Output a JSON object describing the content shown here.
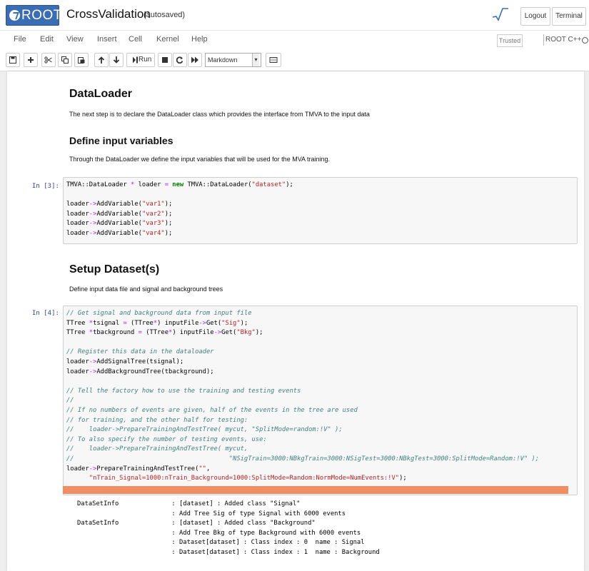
{
  "header": {
    "logo_text": "ROOT",
    "notebook_name": "CrossValidation",
    "autosave_status": "(autosaved)",
    "logout_label": "Logout",
    "terminal_label": "Terminal"
  },
  "menubar": {
    "items": [
      "File",
      "Edit",
      "View",
      "Insert",
      "Cell",
      "Kernel",
      "Help"
    ],
    "trusted_label": "Trusted",
    "kernel_name": "ROOT C++"
  },
  "toolbar": {
    "run_label": "Run",
    "cell_type": "Markdown",
    "icons": [
      "save-icon",
      "insert-cell-icon",
      "cut-icon",
      "copy-icon",
      "paste-icon",
      "move-up-icon",
      "move-down-icon",
      "run-icon",
      "interrupt-icon",
      "restart-icon",
      "restart-run-all-icon",
      "command-palette-icon"
    ]
  },
  "cells": {
    "md1": {
      "h2": "DataLoader",
      "para": "The next step is to declare the DataLoader class which provides the interface from TMVA to the input data",
      "h3": "Define input variables",
      "para2": "Through the DataLoader we define the input variables that will be used for the MVA training."
    },
    "code1": {
      "prompt": "In [3]:",
      "line1": {
        "a": "TMVA::DataLoader ",
        "op": "*",
        "b": " loader ",
        "eq": "=",
        "kw": " new",
        "c": " TMVA::DataLoader(",
        "s": "\"dataset\"",
        "d": ");"
      },
      "vars": [
        "\"var1\"",
        "\"var2\"",
        "\"var3\"",
        "\"var4\""
      ],
      "call_prefix": "loader",
      "arrow": "->",
      "call_name": "AddVariable(",
      "call_end": ");"
    },
    "md2": {
      "h2": "Setup Dataset(s)",
      "para": "Define input data file and signal and background trees"
    },
    "code2": {
      "prompt": "In [4]:",
      "c1": "// Get signal and background data from input file",
      "l2a": "TTree ",
      "l2op": "*",
      "l2b": "tsignal ",
      "l2eq": "=",
      "l2c": " (TTree",
      "l2op2": "*",
      "l2d": ") inputFile",
      "l2arrow": "->",
      "l2e": "Get(",
      "l2s": "\"Sig\"",
      "l2f": ");",
      "l3a": "TTree ",
      "l3op": "*",
      "l3b": "tbackground ",
      "l3eq": "=",
      "l3c": " (TTree",
      "l3op2": "*",
      "l3d": ") inputFile",
      "l3arrow": "->",
      "l3e": "Get(",
      "l3s": "\"Bkg\"",
      "l3f": ");",
      "c2": "// Register this data in the dataloader",
      "l5a": "loader",
      "l5arrow": "->",
      "l5b": "AddSignalTree(tsignal);",
      "l6a": "loader",
      "l6arrow": "->",
      "l6b": "AddBackgroundTree(tbackground);",
      "c3": "// Tell the factory how to use the training and testing events",
      "c4": "//",
      "c5": "// If no numbers of events are given, half of the events in the tree are used",
      "c6": "// for training, and the other half for testing:",
      "c7": "//    loader->PrepareTrainingAndTestTree( mycut, \"SplitMode=random:!V\" );",
      "c8": "// To also specify the number of testing events, use:",
      "c9": "//    loader->PrepareTrainingAndTestTree( mycut,",
      "c10": "//                                         \"NSigTrain=3000:NBkgTrain=3000:NSigTest=3000:NBkgTest=3000:SplitMode=Random:!V\" );",
      "l17a": "loader",
      "l17arrow": "->",
      "l17b": "PrepareTrainingAndTestTree(",
      "l17s": "\"\"",
      "l17c": ",",
      "l18s": "\"nTrain_Signal=1000:nTrain_Background=1000:SplitMode=Random:NormMode=NumEvents:!V\"",
      "l18c": ");"
    },
    "output": {
      "lines": [
        "DataSetInfo              : [dataset] : Added class \"Signal\"",
        "                         : Add Tree Sig of type Signal with 6000 events",
        "DataSetInfo              : [dataset] : Added class \"Background\"",
        "                         : Add Tree Bkg of type Background with 6000 events",
        "                         : Dataset[dataset] : Class index : 0  name : Signal",
        "                         : Dataset[dataset] : Class index : 1  name : Background"
      ]
    }
  }
}
